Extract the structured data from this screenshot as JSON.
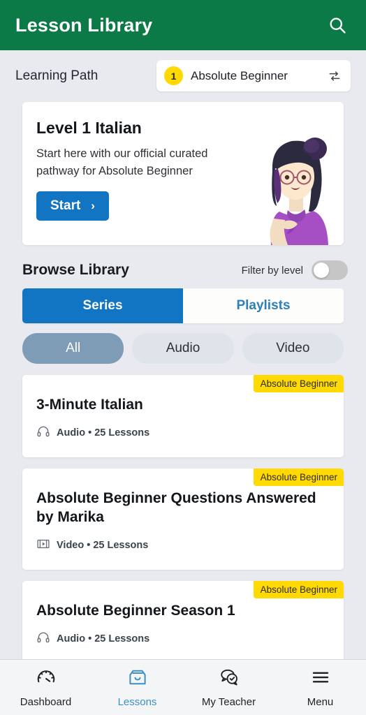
{
  "header": {
    "title": "Lesson Library",
    "search_icon": "search-icon"
  },
  "learning_path": {
    "label": "Learning Path",
    "level_number": "1",
    "level_name": "Absolute Beginner",
    "swap_icon": "swap-icon"
  },
  "level_card": {
    "title": "Level 1 Italian",
    "description": "Start here with our official curated pathway for Absolute Beginner",
    "start_label": "Start",
    "chevron": "›",
    "illustration": "teacher-illustration"
  },
  "browse": {
    "title": "Browse Library",
    "filter_label": "Filter by level",
    "filter_on": false,
    "tabs": [
      {
        "label": "Series",
        "active": true
      },
      {
        "label": "Playlists",
        "active": false
      }
    ],
    "pills": [
      {
        "label": "All",
        "active": true
      },
      {
        "label": "Audio",
        "active": false
      },
      {
        "label": "Video",
        "active": false
      }
    ]
  },
  "lessons": [
    {
      "title": "3-Minute Italian",
      "badge": "Absolute Beginner",
      "media_icon": "headphones-icon",
      "meta": "Audio • 25 Lessons"
    },
    {
      "title": "Absolute Beginner Questions Answered by Marika",
      "badge": "Absolute Beginner",
      "media_icon": "video-icon",
      "meta": "Video • 25 Lessons"
    },
    {
      "title": "Absolute Beginner Season 1",
      "badge": "Absolute Beginner",
      "media_icon": "headphones-icon",
      "meta": "Audio • 25 Lessons"
    }
  ],
  "bottom_nav": [
    {
      "label": "Dashboard",
      "icon": "gauge-icon",
      "active": false
    },
    {
      "label": "Lessons",
      "icon": "inbox-icon",
      "active": true
    },
    {
      "label": "My Teacher",
      "icon": "chat-check-icon",
      "active": false
    },
    {
      "label": "Menu",
      "icon": "hamburger-icon",
      "active": false
    }
  ],
  "colors": {
    "header_green": "#0c7a47",
    "accent_blue": "#1275c4",
    "badge_yellow": "#ffd900",
    "pill_active": "#7e9cb5",
    "page_bg": "#e9eaf0"
  }
}
